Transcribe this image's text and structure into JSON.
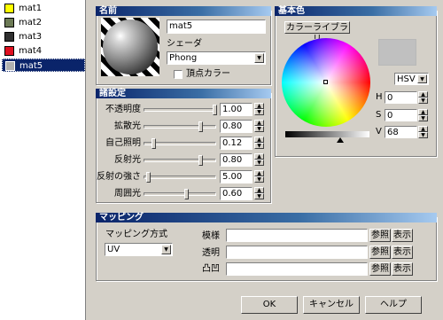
{
  "materials": [
    {
      "label": "mat1",
      "color": "#ffff00"
    },
    {
      "label": "mat2",
      "color": "#6c7a55"
    },
    {
      "label": "mat3",
      "color": "#303030"
    },
    {
      "label": "mat4",
      "color": "#e01020"
    },
    {
      "label": "mat5",
      "color": "#b0b0b0"
    }
  ],
  "name_section": {
    "header": "名前",
    "name_value": "mat5",
    "shader_label": "シェーダ",
    "shader_value": "Phong",
    "vertex_color_label": "頂点カラー",
    "vertex_color_checked": false
  },
  "basic_color": {
    "header": "基本色",
    "library_button": "カラーライブラリ",
    "swatch_color": "#c0c0c0",
    "mode": "HSV",
    "h_label": "H",
    "h_value": "0",
    "s_label": "S",
    "s_value": "0",
    "v_label": "V",
    "v_value": "68",
    "brightness_level": 0.68
  },
  "settings": {
    "header": "諸設定",
    "rows": [
      {
        "label": "不透明度",
        "value": "1.00",
        "level": 1.0
      },
      {
        "label": "拡散光",
        "value": "0.80",
        "level": 0.8
      },
      {
        "label": "自己照明",
        "value": "0.12",
        "level": 0.12
      },
      {
        "label": "反射光",
        "value": "0.80",
        "level": 0.8
      },
      {
        "label": "反射の強さ",
        "value": "5.00",
        "level": 0.05
      },
      {
        "label": "周囲光",
        "value": "0.60",
        "level": 0.6
      }
    ]
  },
  "mapping": {
    "header": "マッピング",
    "method_label": "マッピング方式",
    "method_value": "UV",
    "rows": [
      {
        "label": "模様",
        "value": "",
        "browse": "参照",
        "show": "表示"
      },
      {
        "label": "透明",
        "value": "",
        "browse": "参照",
        "show": "表示"
      },
      {
        "label": "凸凹",
        "value": "",
        "browse": "参照",
        "show": "表示"
      }
    ]
  },
  "footer": {
    "ok": "OK",
    "cancel": "キャンセル",
    "help": "ヘルプ"
  }
}
